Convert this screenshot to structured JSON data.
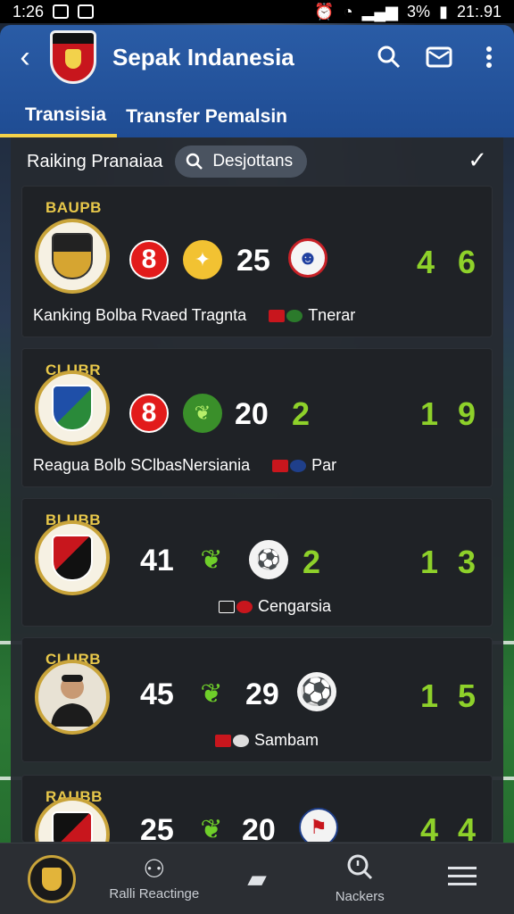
{
  "status": {
    "time_left": "1:26",
    "battery": "3%",
    "time_right": "21:.91"
  },
  "appbar": {
    "title": "Sepak Indanesia"
  },
  "tabs": [
    {
      "label": "Transisia"
    },
    {
      "label": "Transfer Pemalsin"
    }
  ],
  "filter": {
    "label": "Raiking Pranaiaa",
    "search_chip": "Desjottans"
  },
  "cards": [
    {
      "tag": "BAUPB",
      "badge": "8",
      "num1": "25",
      "score_a": "4",
      "score_b": "6",
      "sub_main": "Kanking Bolba Rvaed Tragnta",
      "sub_extra": "Tnerar"
    },
    {
      "tag": "CLUBR",
      "badge": "8",
      "num1": "20",
      "num2": "2",
      "score_a": "1",
      "score_b": "9",
      "sub_main": "Reagua Bolb SClbasNersiania",
      "sub_extra": "Par"
    },
    {
      "tag": "BLUBB",
      "num0": "41",
      "num2": "2",
      "score_a": "1",
      "score_b": "3",
      "sub_extra": "Cengarsia"
    },
    {
      "tag": "CLURB",
      "num0": "45",
      "num1": "29",
      "score_a": "1",
      "score_b": "5",
      "sub_extra": "Sambam"
    },
    {
      "tag": "RAUBB",
      "num0": "25",
      "num1": "20",
      "score_a": "4",
      "score_b": "4"
    }
  ],
  "bottom_nav": [
    {
      "label": ""
    },
    {
      "label": "Ralli Reactinge"
    },
    {
      "label": ""
    },
    {
      "label": "Nackers"
    },
    {
      "label": ""
    }
  ],
  "colors": {
    "accent_green": "#8ed12a",
    "appbar_blue": "#1f4c93",
    "badge_red": "#e21b1b",
    "tab_underline": "#f4d24a"
  },
  "icons": [
    "back-arrow-icon",
    "search-icon",
    "mail-icon",
    "more-vert-icon",
    "check-icon",
    "leaf-icon",
    "soccer-ball-icon",
    "chat-icon",
    "newspaper-icon",
    "search-stats-icon",
    "menu-icon"
  ]
}
